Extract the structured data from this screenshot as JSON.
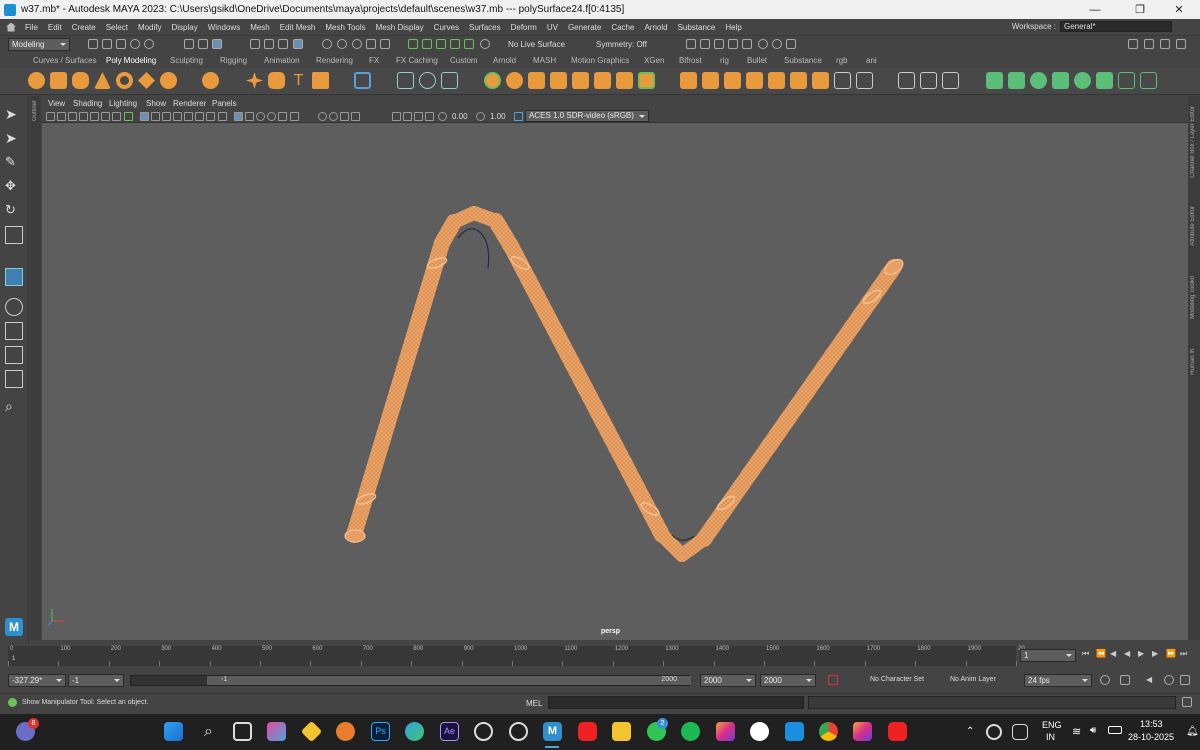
{
  "window": {
    "title": "w37.mb* - Autodesk MAYA 2023: C:\\Users\\gsikd\\OneDrive\\Documents\\maya\\projects\\default\\scenes\\w37.mb   ---   polySurface24.f[0:4135]",
    "minimize": "—",
    "restore": "❐",
    "close": "✕"
  },
  "menubar": {
    "items": [
      "File",
      "Edit",
      "Create",
      "Select",
      "Modify",
      "Display",
      "Windows",
      "Mesh",
      "Edit Mesh",
      "Mesh Tools",
      "Mesh Display",
      "Curves",
      "Surfaces",
      "Deform",
      "UV",
      "Generate",
      "Cache",
      "Arnold",
      "Substance",
      "Help"
    ],
    "workspace_label": "Workspace :",
    "workspace_value": "General*"
  },
  "statusline": {
    "mode": "Modeling",
    "live_surface": "No Live Surface",
    "symmetry": "Symmetry: Off"
  },
  "shelf": {
    "tabs": [
      "Curves / Surfaces",
      "Poly Modeling",
      "Sculpting",
      "Rigging",
      "Animation",
      "Rendering",
      "FX",
      "FX Caching",
      "Custom",
      "Arnold",
      "MASH",
      "Motion Graphics",
      "XGen",
      "Bifrost",
      "rig",
      "Bullet",
      "Substance",
      "rgb",
      "ani"
    ],
    "active_tab": "Poly Modeling"
  },
  "panel": {
    "menus": [
      "View",
      "Shading",
      "Lighting",
      "Show",
      "Renderer",
      "Panels"
    ],
    "exposure": "0.00",
    "gamma": "1.00",
    "colorspace": "ACES 1.0 SDR-video (sRGB)",
    "camera_label": "persp"
  },
  "side_panels": {
    "left": "Outliner",
    "right": [
      "Channel Box / Layer Editor",
      "Attribute Editor",
      "Modeling Toolkit",
      "Human IK"
    ]
  },
  "timeline": {
    "ticks": [
      "0",
      "100",
      "200",
      "300",
      "400",
      "500",
      "600",
      "700",
      "800",
      "900",
      "1000",
      "1100",
      "1200",
      "1300",
      "1400",
      "1500",
      "1600",
      "1700",
      "1800",
      "1900",
      "20"
    ],
    "current_frame_marker": "1",
    "current_frame_field": "1"
  },
  "range": {
    "field1": "-327.29*",
    "field2": "-1",
    "slider_start": "-1",
    "slider_end": "2000",
    "end1": "2000",
    "end2": "2000",
    "character_set": "No Character Set",
    "anim_layer": "No Anim Layer",
    "fps": "24 fps"
  },
  "command": {
    "help_text": "Show Manipulator Tool: Select an object.",
    "mel_label": "MEL"
  },
  "taskbar": {
    "notification_badge": "8",
    "whatsapp_badge": "2",
    "language_line1": "ENG",
    "language_line2": "IN",
    "time": "13:53",
    "date": "28-10-2025"
  },
  "colors": {
    "mesh_wire": "#f2b377",
    "mesh_shade": "#d98a4c",
    "viewport_bg": "#5e5e5e",
    "accent_blue": "#4aa3df"
  }
}
